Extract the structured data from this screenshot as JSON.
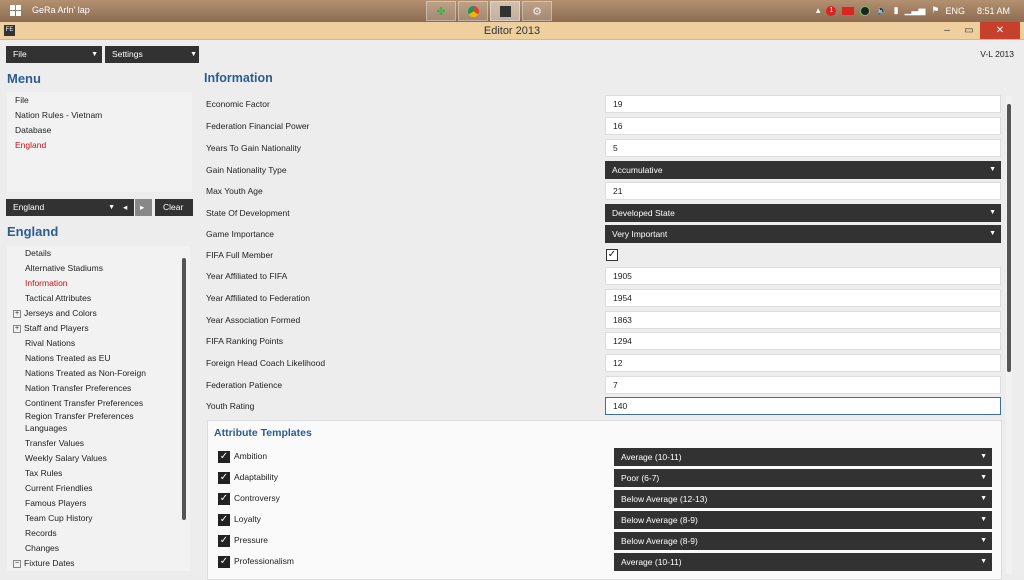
{
  "taskbar": {
    "user": "GeRa Arln' lap",
    "lang": "ENG",
    "time": "8:51 AM",
    "tray_badge": "1"
  },
  "window": {
    "title": "Editor 2013",
    "minimize": "–",
    "restore": "▭",
    "close": "✕"
  },
  "toolbar": {
    "file": "File",
    "settings": "Settings",
    "version": "V-L 2013"
  },
  "menu": {
    "title": "Menu",
    "items": [
      "File",
      "Nation Rules - Vietnam",
      "Database",
      "England"
    ]
  },
  "nation_select": {
    "value": "England",
    "clear": "Clear"
  },
  "nation": {
    "title": "England",
    "items": [
      "Details",
      "Alternative Stadiums",
      "Information",
      "Tactical Attributes",
      "Jerseys and Colors",
      "Staff and Players",
      "Rival Nations",
      "Nations Treated as EU",
      "Nations Treated as Non-Foreign",
      "Nation Transfer Preferences",
      "Continent Transfer Preferences",
      "Region Transfer Preferences",
      "Languages",
      "Transfer Values",
      "Weekly Salary Values",
      "Tax Rules",
      "Current Friendlies",
      "Famous Players",
      "Team Cup History",
      "Records",
      "Changes",
      "Fixture Dates"
    ]
  },
  "info": {
    "title": "Information",
    "fields": [
      {
        "label": "Economic Factor",
        "value": "19"
      },
      {
        "label": "Federation Financial Power",
        "value": "16"
      },
      {
        "label": "Years To Gain Nationality",
        "value": "5"
      },
      {
        "label": "Gain Nationality Type",
        "value": "Accumulative"
      },
      {
        "label": "Max Youth Age",
        "value": "21"
      },
      {
        "label": "State Of Development",
        "value": "Developed State"
      },
      {
        "label": "Game Importance",
        "value": "Very Important"
      },
      {
        "label": "FIFA Full Member",
        "value": "✓"
      },
      {
        "label": "Year Affiliated to FIFA",
        "value": "1905"
      },
      {
        "label": "Year Affiliated to Federation",
        "value": "1954"
      },
      {
        "label": "Year Association Formed",
        "value": "1863"
      },
      {
        "label": "FIFA Ranking Points",
        "value": "1294"
      },
      {
        "label": "Foreign Head Coach Likelihood",
        "value": "12"
      },
      {
        "label": "Federation Patience",
        "value": "7"
      },
      {
        "label": "Youth Rating",
        "value": "140"
      }
    ]
  },
  "attributes": {
    "title": "Attribute Templates",
    "items": [
      {
        "label": "Ambition",
        "value": "Average (10-11)"
      },
      {
        "label": "Adaptability",
        "value": "Poor (6-7)"
      },
      {
        "label": "Controversy",
        "value": "Below Average (12-13)"
      },
      {
        "label": "Loyalty",
        "value": "Below Average (8-9)"
      },
      {
        "label": "Pressure",
        "value": "Below Average (8-9)"
      },
      {
        "label": "Professionalism",
        "value": "Average (10-11)"
      }
    ]
  }
}
